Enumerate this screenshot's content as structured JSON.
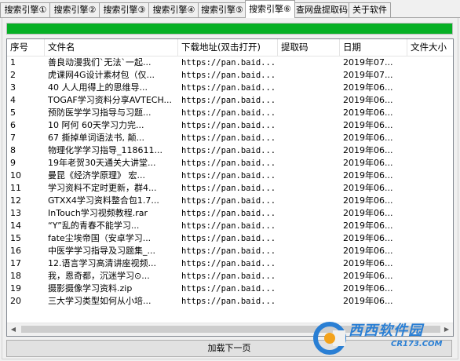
{
  "tabs": [
    {
      "label": "搜索引擎①",
      "active": false
    },
    {
      "label": "搜索引擎②",
      "active": false
    },
    {
      "label": "搜索引擎③",
      "active": false
    },
    {
      "label": "搜索引擎④",
      "active": false
    },
    {
      "label": "搜索引擎⑤",
      "active": false
    },
    {
      "label": "搜索引擎⑥",
      "active": true
    },
    {
      "label": "查网盘提取码",
      "active": false
    },
    {
      "label": "关于软件",
      "active": false
    }
  ],
  "progress": {
    "percent": 100,
    "color": "#06b025"
  },
  "table": {
    "headers": [
      "序号",
      "文件名",
      "下载地址(双击打开)",
      "提取码",
      "日期",
      "文件大小"
    ],
    "rows": [
      [
        "1",
        "善良动漫我们`无法`一起...",
        "https://pan.baid...",
        "",
        "2019年07...",
        ""
      ],
      [
        "2",
        "虎课网4G设计素材包（仅...",
        "https://pan.baid...",
        "",
        "2019年07...",
        ""
      ],
      [
        "3",
        "40   人人用得上的思维导...",
        "https://pan.baid...",
        "",
        "2019年06...",
        ""
      ],
      [
        "4",
        "TOGAF学习资料分享AVTECH...",
        "https://pan.baid...",
        "",
        "2019年06...",
        ""
      ],
      [
        "5",
        "预防医学学习指导与习题...",
        "https://pan.baid...",
        "",
        "2019年06...",
        ""
      ],
      [
        "6",
        "10   阿何 60天学习力完...",
        "https://pan.baid...",
        "",
        "2019年06...",
        ""
      ],
      [
        "7",
        "67   撕掉单词语法书, 颠...",
        "https://pan.baid...",
        "",
        "2019年06...",
        ""
      ],
      [
        "8",
        "物理化学学习指导_118611...",
        "https://pan.baid...",
        "",
        "2019年06...",
        ""
      ],
      [
        "9",
        "19年老贺30天通关大讲堂...",
        "https://pan.baid...",
        "",
        "2019年06...",
        ""
      ],
      [
        "10",
        "曼昆《经济学原理》   宏...",
        "https://pan.baid...",
        "",
        "2019年06...",
        ""
      ],
      [
        "11",
        "学习资料不定时更新，群4...",
        "https://pan.baid...",
        "",
        "2019年06...",
        ""
      ],
      [
        "12",
        "GTXX4学习资料整合包1.7...",
        "https://pan.baid...",
        "",
        "2019年06...",
        ""
      ],
      [
        "13",
        "InTouch学习视频教程.rar",
        "https://pan.baid...",
        "",
        "2019年06...",
        ""
      ],
      [
        "14",
        "“Y”乱的青春不能学习...",
        "https://pan.baid...",
        "",
        "2019年06...",
        ""
      ],
      [
        "15",
        "fate尘埃帝国（安卓学习...",
        "https://pan.baid...",
        "",
        "2019年06...",
        ""
      ],
      [
        "16",
        "中医学学习指导及习题集_...",
        "https://pan.baid...",
        "",
        "2019年06...",
        ""
      ],
      [
        "17",
        "12.语言学习高清讲座视频...",
        "https://pan.baid...",
        "",
        "2019年06...",
        ""
      ],
      [
        "18",
        "我，恩奇都，沉迷学习⊙...",
        "https://pan.baid...",
        "",
        "2019年06...",
        ""
      ],
      [
        "19",
        "摄影摄像学习资料.zip",
        "https://pan.baid...",
        "",
        "2019年06...",
        ""
      ],
      [
        "20",
        "三大学习类型如何从小培...",
        "https://pan.baid...",
        "",
        "2019年06...",
        ""
      ]
    ]
  },
  "next_button": {
    "label": "加载下一页"
  },
  "watermark": {
    "brand": "西西软件园",
    "domain": "CR173.COM"
  }
}
